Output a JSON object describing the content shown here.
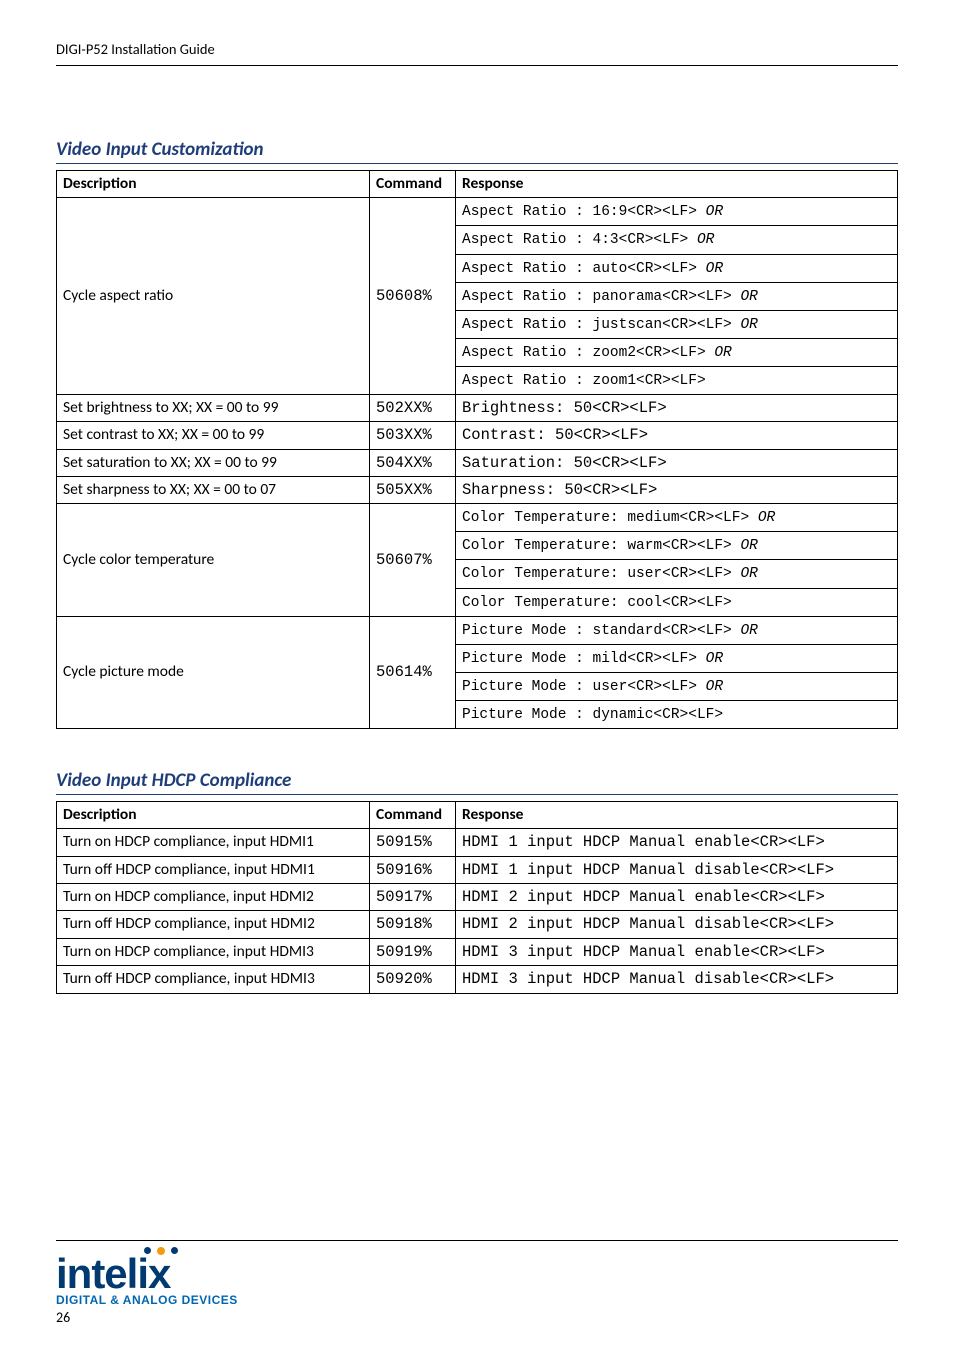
{
  "header": "DIGI-P52 Installation Guide",
  "section1": {
    "title": "Video Input Customization",
    "col_desc": "Description",
    "col_cmd": "Command",
    "col_resp": "Response",
    "row_aspect": {
      "desc": "Cycle aspect ratio",
      "cmd": "50608%",
      "responses": [
        {
          "r": "Aspect Ratio : 16:9<CR><LF>",
          "or": " OR"
        },
        {
          "r": "Aspect Ratio : 4:3<CR><LF>",
          "or": " OR"
        },
        {
          "r": "Aspect Ratio : auto<CR><LF>",
          "or": " OR"
        },
        {
          "r": "Aspect Ratio : panorama<CR><LF>",
          "or": " OR"
        },
        {
          "r": "Aspect Ratio : justscan<CR><LF>",
          "or": " OR"
        },
        {
          "r": "Aspect Ratio : zoom2<CR><LF>",
          "or": " OR"
        },
        {
          "r": "Aspect Ratio : zoom1<CR><LF>",
          "or": ""
        }
      ]
    },
    "row_bright": {
      "desc": "Set brightness to XX; XX = 00 to 99",
      "cmd": "502XX%",
      "resp": "Brightness: 50<CR><LF>"
    },
    "row_contrast": {
      "desc": "Set contrast to XX; XX = 00 to 99",
      "cmd": "503XX%",
      "resp": "Contrast: 50<CR><LF>"
    },
    "row_sat": {
      "desc": "Set saturation to XX; XX = 00 to 99",
      "cmd": "504XX%",
      "resp": "Saturation: 50<CR><LF>"
    },
    "row_sharp": {
      "desc": "Set sharpness to XX; XX = 00 to 07",
      "cmd": "505XX%",
      "resp": "Sharpness: 50<CR><LF>"
    },
    "row_color": {
      "desc": "Cycle color temperature",
      "cmd": "50607%",
      "responses": [
        {
          "r": "Color Temperature: medium<CR><LF>",
          "or": " OR"
        },
        {
          "r": "Color Temperature: warm<CR><LF>",
          "or": " OR"
        },
        {
          "r": "Color Temperature: user<CR><LF>",
          "or": " OR"
        },
        {
          "r": "Color Temperature: cool<CR><LF>",
          "or": ""
        }
      ]
    },
    "row_picture": {
      "desc": "Cycle picture mode",
      "cmd": "50614%",
      "responses": [
        {
          "r": "Picture Mode : standard<CR><LF>",
          "or": " OR"
        },
        {
          "r": "Picture Mode : mild<CR><LF>",
          "or": " OR"
        },
        {
          "r": "Picture Mode : user<CR><LF>",
          "or": " OR"
        },
        {
          "r": "Picture Mode : dynamic<CR><LF>",
          "or": ""
        }
      ]
    }
  },
  "section2": {
    "title": "Video Input HDCP Compliance",
    "col_desc": "Description",
    "col_cmd": "Command",
    "col_resp": "Response",
    "rows": [
      {
        "desc": "Turn on HDCP compliance, input HDMI1",
        "cmd": "50915%",
        "resp": "HDMI 1 input HDCP Manual enable<CR><LF>"
      },
      {
        "desc": "Turn off HDCP compliance, input HDMI1",
        "cmd": "50916%",
        "resp": "HDMI 1 input HDCP Manual disable<CR><LF>"
      },
      {
        "desc": "Turn on HDCP compliance, input HDMI2",
        "cmd": "50917%",
        "resp": "HDMI 2 input HDCP Manual enable<CR><LF>"
      },
      {
        "desc": "Turn off HDCP compliance, input HDMI2",
        "cmd": "50918%",
        "resp": "HDMI 2 input HDCP Manual disable<CR><LF>"
      },
      {
        "desc": "Turn on HDCP compliance, input HDMI3",
        "cmd": "50919%",
        "resp": "HDMI 3 input HDCP Manual enable<CR><LF>"
      },
      {
        "desc": "Turn off HDCP compliance, input HDMI3",
        "cmd": "50920%",
        "resp": "HDMI 3 input HDCP Manual disable<CR><LF>"
      }
    ]
  },
  "logo": {
    "word": "intelix",
    "sub": "DIGITAL & ANALOG DEVICES"
  },
  "page_num": "26"
}
